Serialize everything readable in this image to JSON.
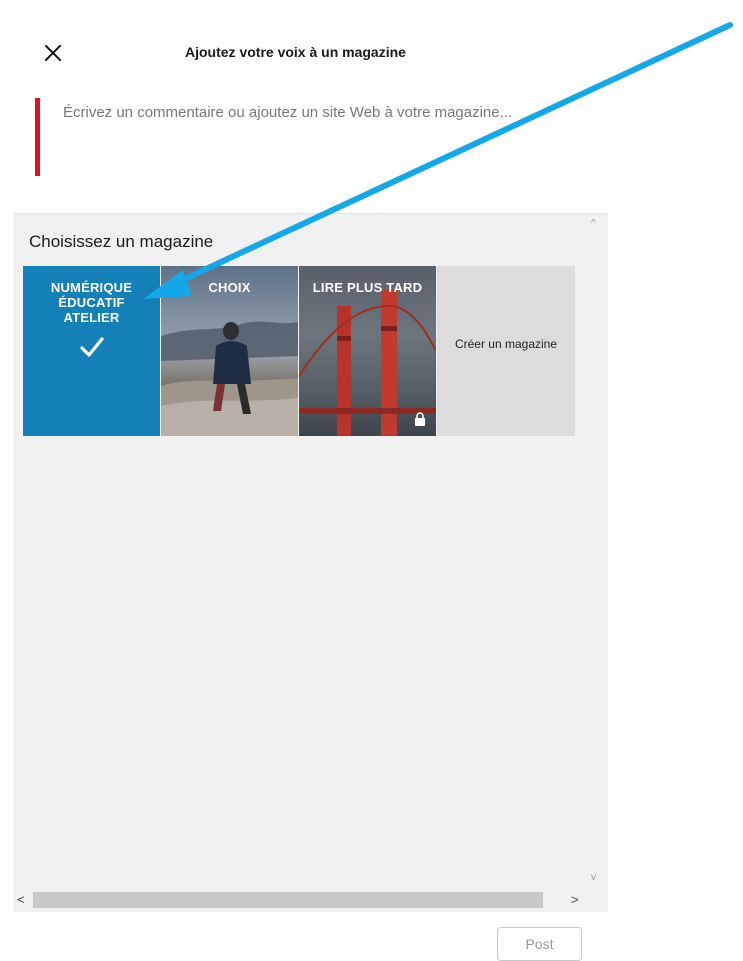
{
  "header": {
    "title": "Ajoutez votre voix à un magazine",
    "close_icon": "close-icon"
  },
  "composer": {
    "placeholder": "Écrivez un commentaire ou ajoutez un site Web à votre magazine...",
    "value": "",
    "accent_color": "#e01020"
  },
  "picker": {
    "title": "Choisissez un magazine",
    "magazines": [
      {
        "label": "NUMÉRIQUE ÉDUCATIF ATELIER",
        "selected": true,
        "icon": "checkmark-icon",
        "color": "#1480b8"
      },
      {
        "label": "CHOIX",
        "selected": false
      },
      {
        "label": "LIRE PLUS TARD",
        "selected": false,
        "icon": "lock-icon"
      },
      {
        "label": "Créer un magazine",
        "selected": false
      }
    ]
  },
  "annotation": {
    "color": "#14a8e8",
    "icon": "arrow-pointer-icon"
  },
  "footer": {
    "post_label": "Post"
  }
}
